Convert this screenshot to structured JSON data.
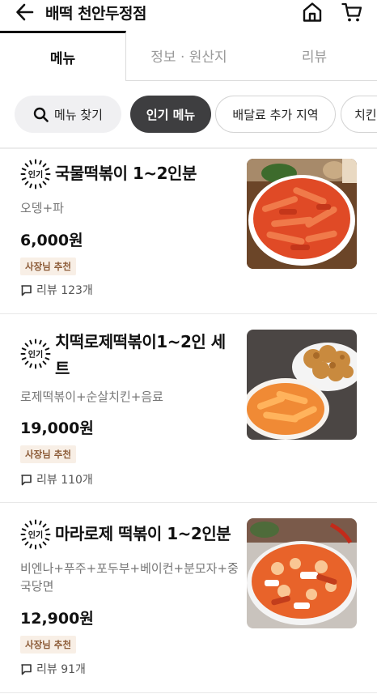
{
  "header": {
    "title": "배떡 천안두정점",
    "back_icon": "arrow-left-icon",
    "home_icon": "home-icon",
    "cart_icon": "cart-icon"
  },
  "tabs": [
    {
      "label": "메뉴",
      "active": true
    },
    {
      "label": "정보 · 원산지",
      "active": false
    },
    {
      "label": "리뷰",
      "active": false
    }
  ],
  "chips": {
    "search_label": "메뉴 찾기",
    "search_icon": "search-icon",
    "items": [
      "인기 메뉴",
      "배달료 추가 지역",
      "치킨"
    ]
  },
  "badge_text": "인기",
  "menu_items": [
    {
      "name": "국물떡볶이 1~2인분",
      "description": "오뎅+파",
      "price": "6,000원",
      "tag": "사장님 추천",
      "reviews": "리뷰 123개"
    },
    {
      "name": "치떡로제떡볶이1~2인 세트",
      "description": "로제떡볶이+순살치킨+음료",
      "price": "19,000원",
      "tag": "사장님 추천",
      "reviews": "리뷰 110개"
    },
    {
      "name": "마라로제 떡볶이 1~2인분",
      "description": "비엔나+푸주+포두부+베이컨+분모자+중국당면",
      "price": "12,900원",
      "tag": "사장님 추천",
      "reviews": "리뷰 91개"
    }
  ],
  "colors": {
    "active_chip": "#3e3e40",
    "tag_bg": "#f8efe6",
    "tag_text": "#8b5a36"
  }
}
